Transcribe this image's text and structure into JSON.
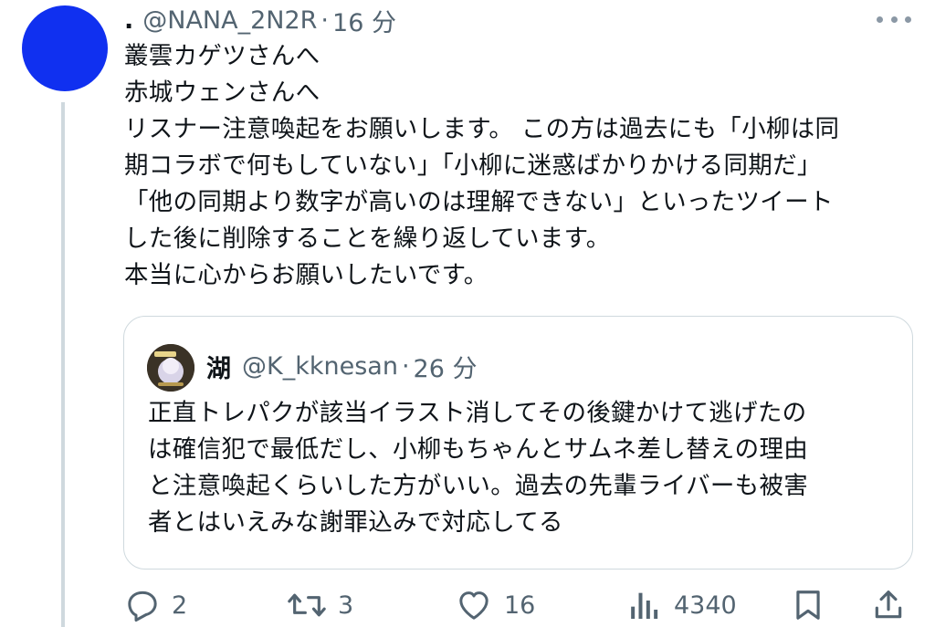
{
  "tweet": {
    "author_name": ".",
    "handle": "@NANA_2N2R",
    "separator": "·",
    "time": "16 分",
    "lines": [
      "叢雲カゲツさんへ",
      "赤城ウェンさんへ",
      "リスナー注意喚起をお願いします。 この方は過去にも「小柳は同",
      "期コラボで何もしていない」「小柳に迷惑ばかりかける同期だ」",
      "「他の同期より数字が高いのは理解できない」といったツイート",
      "した後に削除することを繰り返しています。",
      "本当に心からお願いしたいです。"
    ]
  },
  "quote": {
    "author_name": "湖",
    "handle": "@K_kknesan",
    "separator": "·",
    "time": "26 分",
    "lines": [
      "正直トレパクが該当イラスト消してその後鍵かけて逃げたの",
      "は確信犯で最低だし、小柳もちゃんとサムネ差し替えの理由",
      "と注意喚起くらいした方がいい。過去の先輩ライバーも被害",
      "者とはいえみな謝罪込みで対応してる"
    ]
  },
  "actions": {
    "reply_count": "2",
    "repost_count": "3",
    "like_count": "16",
    "views_count": "4340"
  },
  "colors": {
    "avatar": "#1030f0",
    "muted": "#536471",
    "text": "#0f1419",
    "border": "#cfd9de"
  }
}
